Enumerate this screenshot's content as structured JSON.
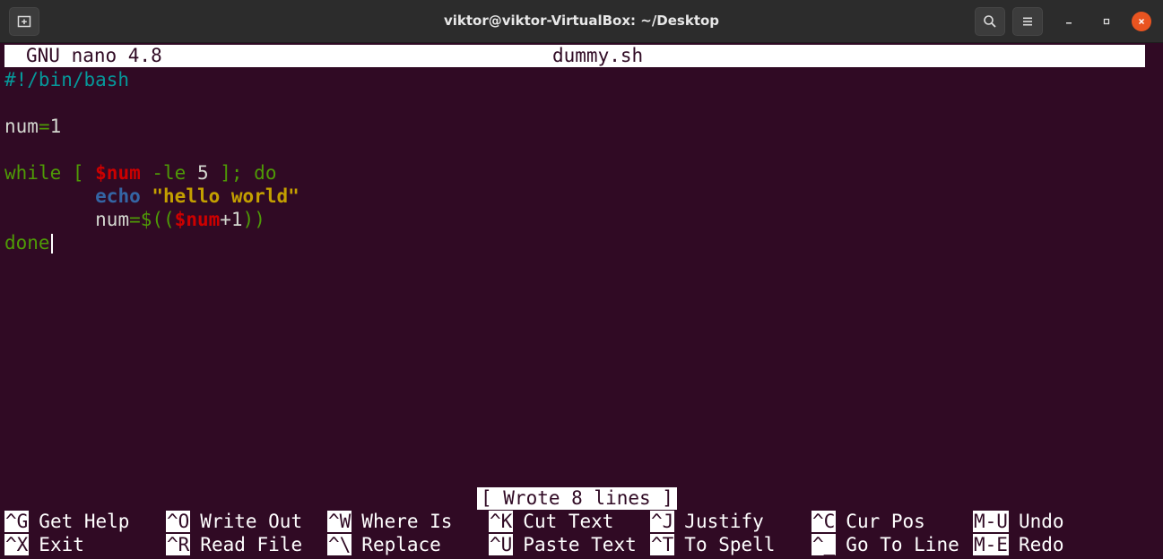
{
  "window": {
    "title": "viktor@viktor-VirtualBox: ~/Desktop",
    "icons": {
      "new_tab": "new-tab-icon",
      "search": "search-icon",
      "menu": "hamburger-menu-icon",
      "minimize": "minimize-icon",
      "maximize": "maximize-icon",
      "close": "close-icon"
    },
    "colors": {
      "titlebar": "#2c2c2c",
      "close": "#e95420",
      "terminal_bg": "#300a24"
    }
  },
  "nano": {
    "version": "GNU nano 4.8",
    "filename": "dummy.sh",
    "status": "[ Wrote 8 lines ]"
  },
  "code": {
    "shebang": "#!/bin/bash",
    "line3": {
      "name": "num",
      "op": "=",
      "value": "1"
    },
    "line5": {
      "kw": "while",
      "open": " [ ",
      "var": "$num",
      "test": " -le ",
      "num": "5",
      "close": " ]; do"
    },
    "line6": {
      "indent": "        ",
      "cmd": "echo",
      "space": " ",
      "str": "\"hello world\""
    },
    "line7": {
      "indent": "        ",
      "name": "num",
      "op": "=$((",
      "var": "$num",
      "plus": "+1",
      "close": "))"
    },
    "line8": {
      "kw": "done"
    }
  },
  "shortcuts": [
    {
      "key": "^G",
      "label": "Get Help"
    },
    {
      "key": "^O",
      "label": "Write Out"
    },
    {
      "key": "^W",
      "label": "Where Is"
    },
    {
      "key": "^K",
      "label": "Cut Text"
    },
    {
      "key": "^J",
      "label": "Justify"
    },
    {
      "key": "^C",
      "label": "Cur Pos"
    },
    {
      "key": "M-U",
      "label": "Undo"
    },
    {
      "key": "^X",
      "label": "Exit"
    },
    {
      "key": "^R",
      "label": "Read File"
    },
    {
      "key": "^\\",
      "label": "Replace"
    },
    {
      "key": "^U",
      "label": "Paste Text"
    },
    {
      "key": "^T",
      "label": "To Spell"
    },
    {
      "key": "^_",
      "label": "Go To Line"
    },
    {
      "key": "M-E",
      "label": "Redo"
    }
  ]
}
